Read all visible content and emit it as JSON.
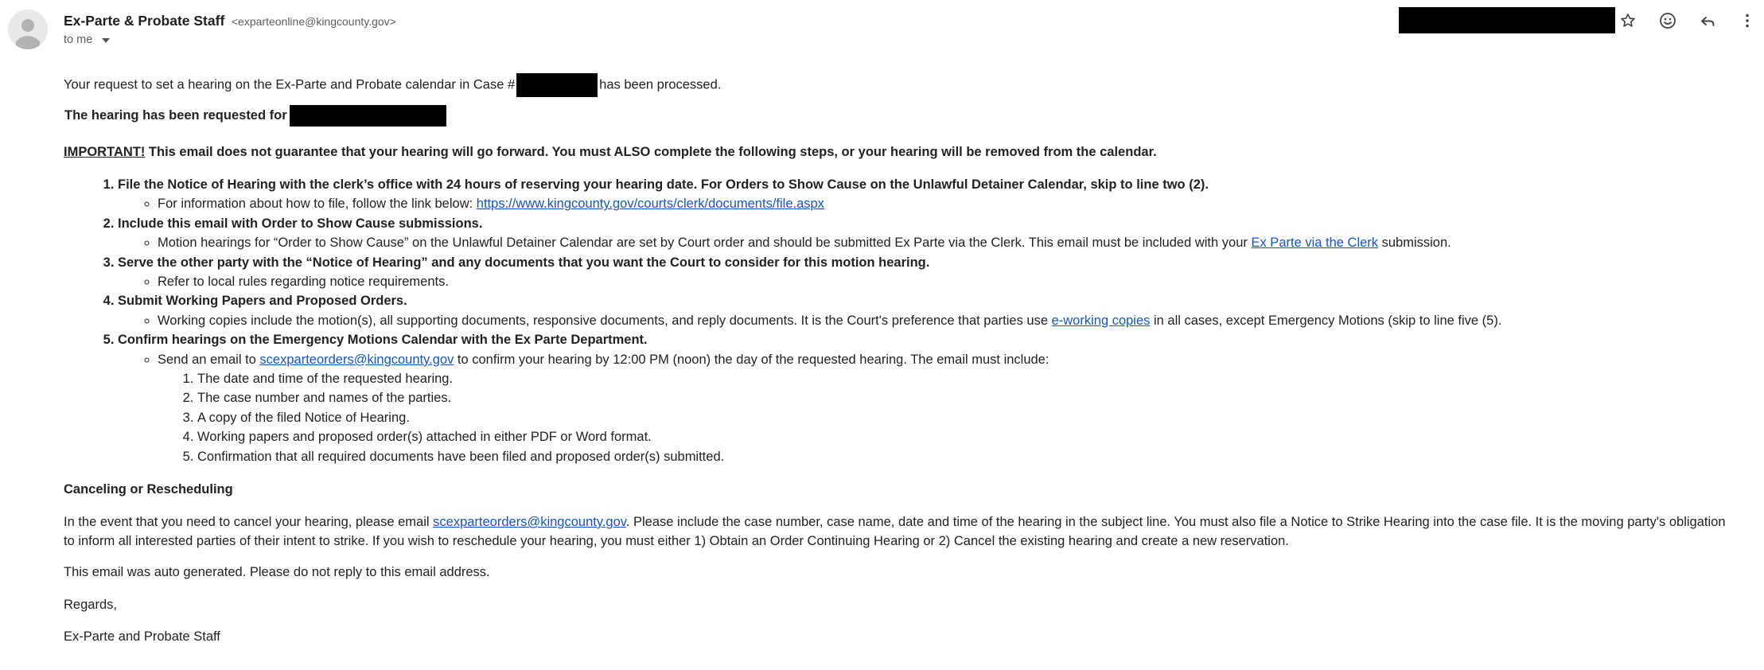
{
  "header": {
    "sender_name": "Ex-Parte & Probate Staff",
    "sender_email": "<exparteonline@kingcounty.gov>",
    "to_label": "to me",
    "icons": [
      "star-icon",
      "emoji-icon",
      "reply-icon",
      "more-vert-icon"
    ]
  },
  "body": {
    "intro_before": "Your request to set a hearing on the Ex-Parte and Probate calendar in Case #",
    "intro_after": "has been processed.",
    "requested_for": "The hearing has been requested for",
    "important_label": "IMPORTANT!",
    "important_text": " This email does not guarantee that your hearing will go forward. You must ALSO complete the following steps, or your hearing will be removed from the calendar.",
    "steps": [
      {
        "title": "File the Notice of Hearing with the clerk’s office with 24 hours of reserving your hearing date. For Orders to Show Cause on the Unlawful Detainer Calendar, skip to line two (2).",
        "sub_before": "For information about how to file, follow the link below: ",
        "sub_link": "https://www.kingcounty.gov/courts/clerk/documents/file.aspx"
      },
      {
        "title": "Include this email with Order to Show Cause submissions.",
        "sub_before": "Motion hearings for “Order to Show Cause” on the Unlawful Detainer Calendar are set by Court order and should be submitted Ex Parte via the Clerk. This email must be included with your ",
        "sub_link": "Ex Parte via the Clerk",
        "sub_after": " submission."
      },
      {
        "title": "Serve the other party with the “Notice of Hearing” and any documents that you want the Court to consider for this motion hearing.",
        "sub_before": "Refer to local rules regarding notice requirements."
      },
      {
        "title": "Submit Working Papers and Proposed Orders.",
        "sub_before": "Working copies include the motion(s), all supporting documents, responsive documents, and reply documents. It is the Court's preference that parties use ",
        "sub_link": "e-working copies",
        "sub_after": " in all cases, except Emergency Motions (skip to line five (5)."
      },
      {
        "title": "Confirm hearings on the Emergency Motions Calendar with the Ex Parte Department.",
        "sub_before": "Send an email to ",
        "sub_link": "scexparteorders@kingcounty.gov",
        "sub_after": " to confirm your hearing by 12:00 PM (noon) the day of the requested hearing. The email must include:",
        "items": [
          "The date and time of the requested hearing.",
          "The case number and names of the parties.",
          "A copy of the filed Notice of Hearing.",
          "Working papers and proposed order(s) attached in either PDF or Word format.",
          "Confirmation that all required documents have been filed and proposed order(s) submitted."
        ]
      }
    ],
    "cancel_title": "Canceling or Rescheduling",
    "cancel_before": "In the event that you need to cancel your hearing, please email ",
    "cancel_link": "scexparteorders@kingcounty.gov",
    "cancel_after": ". Please include the case number, case name, date and time of the hearing in the subject line. You must also file a Notice to Strike Hearing into the case file. It is the moving party's obligation to inform all interested parties of their intent to strike. If you wish to reschedule your hearing, you must either 1) Obtain an Order Continuing Hearing or 2) Cancel the existing hearing and create a new reservation.",
    "auto_generated": "This email was auto generated. Please do not reply to this email address.",
    "regards": "Regards,",
    "signature": "Ex-Parte and Probate Staff"
  }
}
